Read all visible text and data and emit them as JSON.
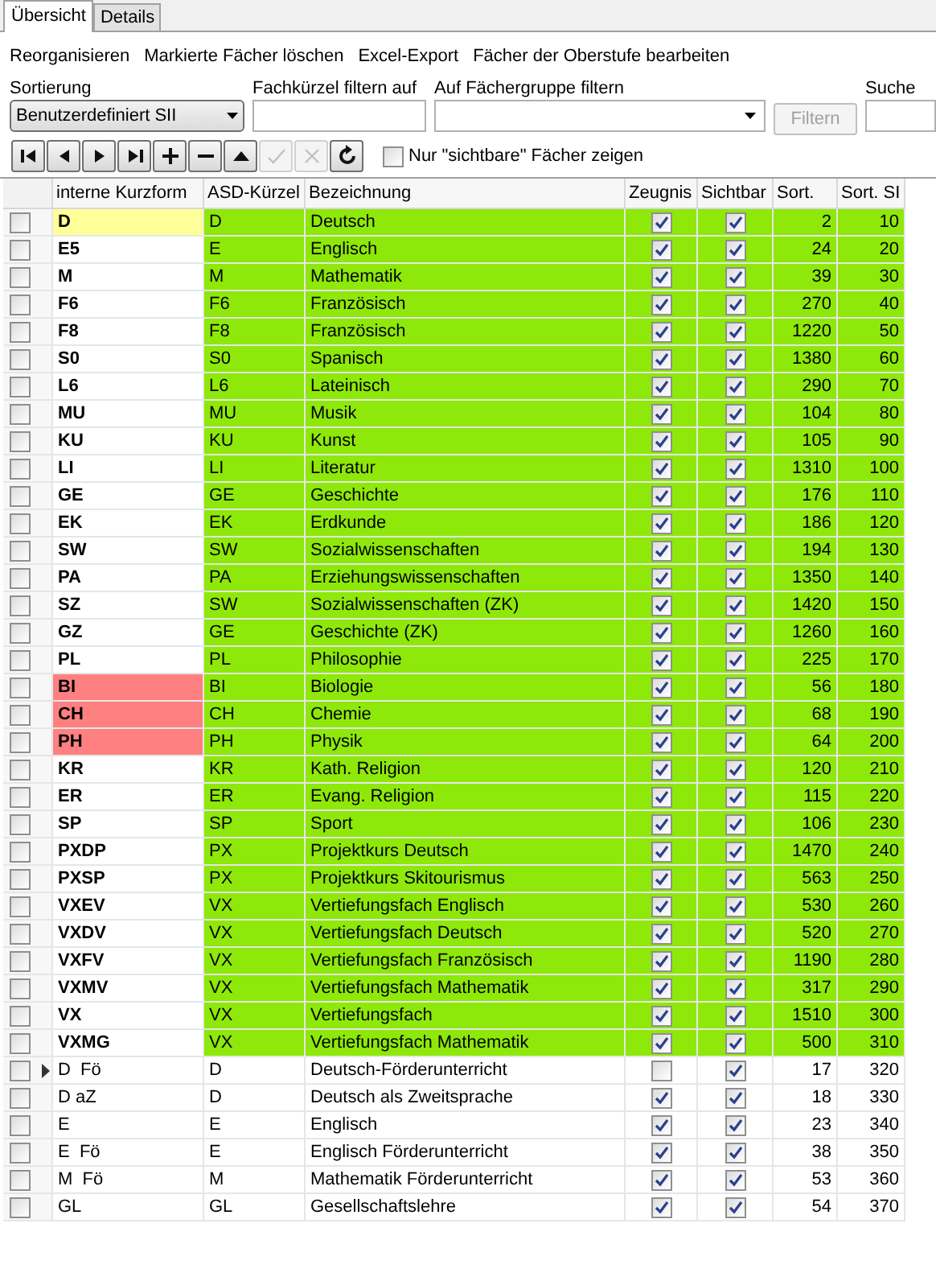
{
  "tabs": [
    {
      "label": "Übersicht",
      "selected": true
    },
    {
      "label": "Details",
      "selected": false
    }
  ],
  "menu": [
    "Reorganisieren",
    "Markierte Fächer löschen",
    "Excel-Export",
    "Fächer der Oberstufe bearbeiten"
  ],
  "filters": {
    "sort_label": "Sortierung",
    "sort_value": "Benutzerdefiniert SII",
    "kuerzel_label": "Fachkürzel filtern auf",
    "group_label": "Auf Fächergruppe filtern",
    "filter_button": "Filtern",
    "filter_disabled": true,
    "search_label": "Suche"
  },
  "nav_buttons": [
    {
      "kind": "first",
      "disabled": false
    },
    {
      "kind": "prev",
      "disabled": false
    },
    {
      "kind": "next",
      "disabled": false
    },
    {
      "kind": "last",
      "disabled": false
    },
    {
      "kind": "add",
      "disabled": false
    },
    {
      "kind": "remove",
      "disabled": false
    },
    {
      "kind": "up",
      "disabled": false
    },
    {
      "kind": "confirm",
      "disabled": true
    },
    {
      "kind": "cancel",
      "disabled": true
    },
    {
      "kind": "refresh",
      "disabled": false
    }
  ],
  "visible_only": {
    "label": "Nur \"sichtbare\" Fächer zeigen",
    "checked": false
  },
  "table": {
    "columns": [
      "interne Kurzform",
      "ASD-Kürzel",
      "Bezeichnung",
      "Zeugnis",
      "Sichtbar",
      "Sort.",
      "Sort. SI"
    ],
    "rows": [
      {
        "short": {
          "text": "D",
          "bold": true,
          "color": "#ffff99"
        },
        "asd": "D",
        "name": "Deutsch",
        "zeugnis": true,
        "sichtbar": true,
        "sort": "2",
        "sort_si": "10",
        "color": "#8ee80a",
        "current": false,
        "checked": false
      },
      {
        "short": {
          "text": "E5",
          "bold": true,
          "color": "#ffffff"
        },
        "asd": "E",
        "name": "Englisch",
        "zeugnis": true,
        "sichtbar": true,
        "sort": "24",
        "sort_si": "20",
        "color": "#8ee80a",
        "current": false,
        "checked": false
      },
      {
        "short": {
          "text": "M",
          "bold": true,
          "color": "#ffffff"
        },
        "asd": "M",
        "name": "Mathematik",
        "zeugnis": true,
        "sichtbar": true,
        "sort": "39",
        "sort_si": "30",
        "color": "#8ee80a",
        "current": false,
        "checked": false
      },
      {
        "short": {
          "text": "F6",
          "bold": true,
          "color": "#ffffff"
        },
        "asd": "F6",
        "name": "Französisch",
        "zeugnis": true,
        "sichtbar": true,
        "sort": "270",
        "sort_si": "40",
        "color": "#8ee80a",
        "current": false,
        "checked": false
      },
      {
        "short": {
          "text": "F8",
          "bold": true,
          "color": "#ffffff"
        },
        "asd": "F8",
        "name": "Französisch",
        "zeugnis": true,
        "sichtbar": true,
        "sort": "1220",
        "sort_si": "50",
        "color": "#8ee80a",
        "current": false,
        "checked": false
      },
      {
        "short": {
          "text": "S0",
          "bold": true,
          "color": "#ffffff"
        },
        "asd": "S0",
        "name": "Spanisch",
        "zeugnis": true,
        "sichtbar": true,
        "sort": "1380",
        "sort_si": "60",
        "color": "#8ee80a",
        "current": false,
        "checked": false
      },
      {
        "short": {
          "text": "L6",
          "bold": true,
          "color": "#ffffff"
        },
        "asd": "L6",
        "name": "Lateinisch",
        "zeugnis": true,
        "sichtbar": true,
        "sort": "290",
        "sort_si": "70",
        "color": "#8ee80a",
        "current": false,
        "checked": false
      },
      {
        "short": {
          "text": "MU",
          "bold": true,
          "color": "#ffffff"
        },
        "asd": "MU",
        "name": "Musik",
        "zeugnis": true,
        "sichtbar": true,
        "sort": "104",
        "sort_si": "80",
        "color": "#8ee80a",
        "current": false,
        "checked": false
      },
      {
        "short": {
          "text": "KU",
          "bold": true,
          "color": "#ffffff"
        },
        "asd": "KU",
        "name": "Kunst",
        "zeugnis": true,
        "sichtbar": true,
        "sort": "105",
        "sort_si": "90",
        "color": "#8ee80a",
        "current": false,
        "checked": false
      },
      {
        "short": {
          "text": "LI",
          "bold": true,
          "color": "#ffffff"
        },
        "asd": "LI",
        "name": "Literatur",
        "zeugnis": true,
        "sichtbar": true,
        "sort": "1310",
        "sort_si": "100",
        "color": "#8ee80a",
        "current": false,
        "checked": false
      },
      {
        "short": {
          "text": "GE",
          "bold": true,
          "color": "#ffffff"
        },
        "asd": "GE",
        "name": "Geschichte",
        "zeugnis": true,
        "sichtbar": true,
        "sort": "176",
        "sort_si": "110",
        "color": "#8ee80a",
        "current": false,
        "checked": false
      },
      {
        "short": {
          "text": "EK",
          "bold": true,
          "color": "#ffffff"
        },
        "asd": "EK",
        "name": "Erdkunde",
        "zeugnis": true,
        "sichtbar": true,
        "sort": "186",
        "sort_si": "120",
        "color": "#8ee80a",
        "current": false,
        "checked": false
      },
      {
        "short": {
          "text": "SW",
          "bold": true,
          "color": "#ffffff"
        },
        "asd": "SW",
        "name": "Sozialwissenschaften",
        "zeugnis": true,
        "sichtbar": true,
        "sort": "194",
        "sort_si": "130",
        "color": "#8ee80a",
        "current": false,
        "checked": false
      },
      {
        "short": {
          "text": "PA",
          "bold": true,
          "color": "#ffffff"
        },
        "asd": "PA",
        "name": "Erziehungswissenschaften",
        "zeugnis": true,
        "sichtbar": true,
        "sort": "1350",
        "sort_si": "140",
        "color": "#8ee80a",
        "current": false,
        "checked": false
      },
      {
        "short": {
          "text": "SZ",
          "bold": true,
          "color": "#ffffff"
        },
        "asd": "SW",
        "name": "Sozialwissenschaften (ZK)",
        "zeugnis": true,
        "sichtbar": true,
        "sort": "1420",
        "sort_si": "150",
        "color": "#8ee80a",
        "current": false,
        "checked": false
      },
      {
        "short": {
          "text": "GZ",
          "bold": true,
          "color": "#ffffff"
        },
        "asd": "GE",
        "name": "Geschichte (ZK)",
        "zeugnis": true,
        "sichtbar": true,
        "sort": "1260",
        "sort_si": "160",
        "color": "#8ee80a",
        "current": false,
        "checked": false
      },
      {
        "short": {
          "text": "PL",
          "bold": true,
          "color": "#ffffff"
        },
        "asd": "PL",
        "name": "Philosophie",
        "zeugnis": true,
        "sichtbar": true,
        "sort": "225",
        "sort_si": "170",
        "color": "#8ee80a",
        "current": false,
        "checked": false
      },
      {
        "short": {
          "text": "BI",
          "bold": true,
          "color": "#ff8080"
        },
        "asd": "BI",
        "name": "Biologie",
        "zeugnis": true,
        "sichtbar": true,
        "sort": "56",
        "sort_si": "180",
        "color": "#8ee80a",
        "current": false,
        "checked": false
      },
      {
        "short": {
          "text": "CH",
          "bold": true,
          "color": "#ff8080"
        },
        "asd": "CH",
        "name": "Chemie",
        "zeugnis": true,
        "sichtbar": true,
        "sort": "68",
        "sort_si": "190",
        "color": "#8ee80a",
        "current": false,
        "checked": false
      },
      {
        "short": {
          "text": "PH",
          "bold": true,
          "color": "#ff8080"
        },
        "asd": "PH",
        "name": "Physik",
        "zeugnis": true,
        "sichtbar": true,
        "sort": "64",
        "sort_si": "200",
        "color": "#8ee80a",
        "current": false,
        "checked": false
      },
      {
        "short": {
          "text": "KR",
          "bold": true,
          "color": "#ffffff"
        },
        "asd": "KR",
        "name": "Kath. Religion",
        "zeugnis": true,
        "sichtbar": true,
        "sort": "120",
        "sort_si": "210",
        "color": "#8ee80a",
        "current": false,
        "checked": false
      },
      {
        "short": {
          "text": "ER",
          "bold": true,
          "color": "#ffffff"
        },
        "asd": "ER",
        "name": "Evang. Religion",
        "zeugnis": true,
        "sichtbar": true,
        "sort": "115",
        "sort_si": "220",
        "color": "#8ee80a",
        "current": false,
        "checked": false
      },
      {
        "short": {
          "text": "SP",
          "bold": true,
          "color": "#ffffff"
        },
        "asd": "SP",
        "name": "Sport",
        "zeugnis": true,
        "sichtbar": true,
        "sort": "106",
        "sort_si": "230",
        "color": "#8ee80a",
        "current": false,
        "checked": false
      },
      {
        "short": {
          "text": "PXDP",
          "bold": true,
          "color": "#ffffff"
        },
        "asd": "PX",
        "name": "Projektkurs Deutsch",
        "zeugnis": true,
        "sichtbar": true,
        "sort": "1470",
        "sort_si": "240",
        "color": "#8ee80a",
        "current": false,
        "checked": false
      },
      {
        "short": {
          "text": "PXSP",
          "bold": true,
          "color": "#ffffff"
        },
        "asd": "PX",
        "name": "Projektkurs Skitourismus",
        "zeugnis": true,
        "sichtbar": true,
        "sort": "563",
        "sort_si": "250",
        "color": "#8ee80a",
        "current": false,
        "checked": false
      },
      {
        "short": {
          "text": "VXEV",
          "bold": true,
          "color": "#ffffff"
        },
        "asd": "VX",
        "name": "Vertiefungsfach Englisch",
        "zeugnis": true,
        "sichtbar": true,
        "sort": "530",
        "sort_si": "260",
        "color": "#8ee80a",
        "current": false,
        "checked": false
      },
      {
        "short": {
          "text": "VXDV",
          "bold": true,
          "color": "#ffffff"
        },
        "asd": "VX",
        "name": "Vertiefungsfach Deutsch",
        "zeugnis": true,
        "sichtbar": true,
        "sort": "520",
        "sort_si": "270",
        "color": "#8ee80a",
        "current": false,
        "checked": false
      },
      {
        "short": {
          "text": "VXFV",
          "bold": true,
          "color": "#ffffff"
        },
        "asd": "VX",
        "name": "Vertiefungsfach Französisch",
        "zeugnis": true,
        "sichtbar": true,
        "sort": "1190",
        "sort_si": "280",
        "color": "#8ee80a",
        "current": false,
        "checked": false
      },
      {
        "short": {
          "text": "VXMV",
          "bold": true,
          "color": "#ffffff"
        },
        "asd": "VX",
        "name": "Vertiefungsfach Mathematik",
        "zeugnis": true,
        "sichtbar": true,
        "sort": "317",
        "sort_si": "290",
        "color": "#8ee80a",
        "current": false,
        "checked": false
      },
      {
        "short": {
          "text": "VX",
          "bold": true,
          "color": "#ffffff"
        },
        "asd": "VX",
        "name": "Vertiefungsfach",
        "zeugnis": true,
        "sichtbar": true,
        "sort": "1510",
        "sort_si": "300",
        "color": "#8ee80a",
        "current": false,
        "checked": false
      },
      {
        "short": {
          "text": "VXMG",
          "bold": true,
          "color": "#ffffff"
        },
        "asd": "VX",
        "name": "Vertiefungsfach Mathematik",
        "zeugnis": true,
        "sichtbar": true,
        "sort": "500",
        "sort_si": "310",
        "color": "#8ee80a",
        "current": false,
        "checked": false
      },
      {
        "short": {
          "text": "D  Fö",
          "bold": false,
          "color": "#ffffff"
        },
        "asd": "D",
        "name": "Deutsch-Förderunterricht",
        "zeugnis": false,
        "sichtbar": true,
        "sort": "17",
        "sort_si": "320",
        "color": "#ffffff",
        "current": true,
        "checked": false
      },
      {
        "short": {
          "text": "D aZ",
          "bold": false,
          "color": "#ffffff"
        },
        "asd": "D",
        "name": "Deutsch als Zweitsprache",
        "zeugnis": true,
        "sichtbar": true,
        "sort": "18",
        "sort_si": "330",
        "color": "#ffffff",
        "current": false,
        "checked": false
      },
      {
        "short": {
          "text": "E",
          "bold": false,
          "color": "#ffffff"
        },
        "asd": "E",
        "name": "Englisch",
        "zeugnis": true,
        "sichtbar": true,
        "sort": "23",
        "sort_si": "340",
        "color": "#ffffff",
        "current": false,
        "checked": false
      },
      {
        "short": {
          "text": "E  Fö",
          "bold": false,
          "color": "#ffffff"
        },
        "asd": "E",
        "name": "Englisch Förderunterricht",
        "zeugnis": true,
        "sichtbar": true,
        "sort": "38",
        "sort_si": "350",
        "color": "#ffffff",
        "current": false,
        "checked": false
      },
      {
        "short": {
          "text": "M  Fö",
          "bold": false,
          "color": "#ffffff"
        },
        "asd": "M",
        "name": "Mathematik Förderunterricht",
        "zeugnis": true,
        "sichtbar": true,
        "sort": "53",
        "sort_si": "360",
        "color": "#ffffff",
        "current": false,
        "checked": false
      },
      {
        "short": {
          "text": "GL",
          "bold": false,
          "color": "#ffffff"
        },
        "asd": "GL",
        "name": "Gesellschaftslehre",
        "zeugnis": true,
        "sichtbar": true,
        "sort": "54",
        "sort_si": "370",
        "color": "#ffffff",
        "current": false,
        "checked": false
      }
    ]
  }
}
